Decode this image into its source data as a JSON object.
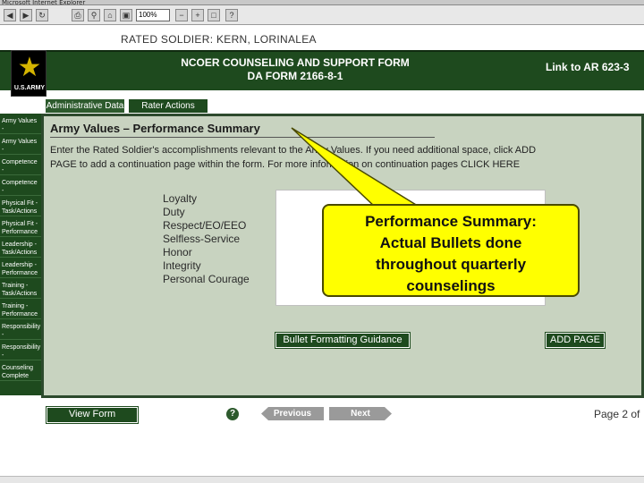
{
  "browser": {
    "url_text": "Microsoft Internet Explorer",
    "zoom": "100%"
  },
  "rated_soldier": "RATED SOLDIER: KERN, LORINALEA",
  "banner": {
    "title_line1": "NCOER COUNSELING AND SUPPORT FORM",
    "title_line2": "DA FORM 2166-8-1",
    "link_label": "Link to AR 623-3",
    "logo_text": "U.S.ARMY"
  },
  "tabs": [
    {
      "label": "Administrative Data"
    },
    {
      "label": "Rater Actions"
    }
  ],
  "sidebar": {
    "items": [
      {
        "label": "Army Values - Task/Actions"
      },
      {
        "label": "Army Values - Performance"
      },
      {
        "label": "Competence - Task/Actions"
      },
      {
        "label": "Competence - Performance"
      },
      {
        "label": "Physical Fit - Task/Actions"
      },
      {
        "label": "Physical Fit - Performance"
      },
      {
        "label": "Leadership - Task/Actions"
      },
      {
        "label": "Leadership - Performance"
      },
      {
        "label": "Training - Task/Actions"
      },
      {
        "label": "Training - Performance"
      },
      {
        "label": "Responsibility - Task/Actions"
      },
      {
        "label": "Responsibility - Performance"
      },
      {
        "label": "Counseling Complete"
      }
    ]
  },
  "main": {
    "section_title": "Army Values – Performance Summary",
    "instructions": "Enter the Rated Soldier's accomplishments relevant to the Army Values. If you need additional space, click ADD PAGE to add a continuation page within the form. For more information on continuation pages",
    "click_here": "CLICK HERE",
    "values": [
      "Loyalty",
      "Duty",
      "Respect/EO/EEO",
      "Selfless-Service",
      "Honor",
      "Integrity",
      "Personal Courage"
    ],
    "bullet_button": "Bullet Formatting Guidance",
    "add_page_button": "ADD PAGE"
  },
  "bottom": {
    "view_form": "View Form",
    "help_icon": "?",
    "previous": "Previous",
    "next": "Next",
    "page_indicator": "Page 2 of"
  },
  "callout": {
    "text_line1": "Performance Summary:",
    "text_line2": "Actual Bullets done",
    "text_line3": "throughout quarterly",
    "text_line4": "counselings"
  },
  "colors": {
    "army_green": "#1e4a1e",
    "panel_bg": "#c8d3c0",
    "callout_yellow": "#ffff00"
  }
}
